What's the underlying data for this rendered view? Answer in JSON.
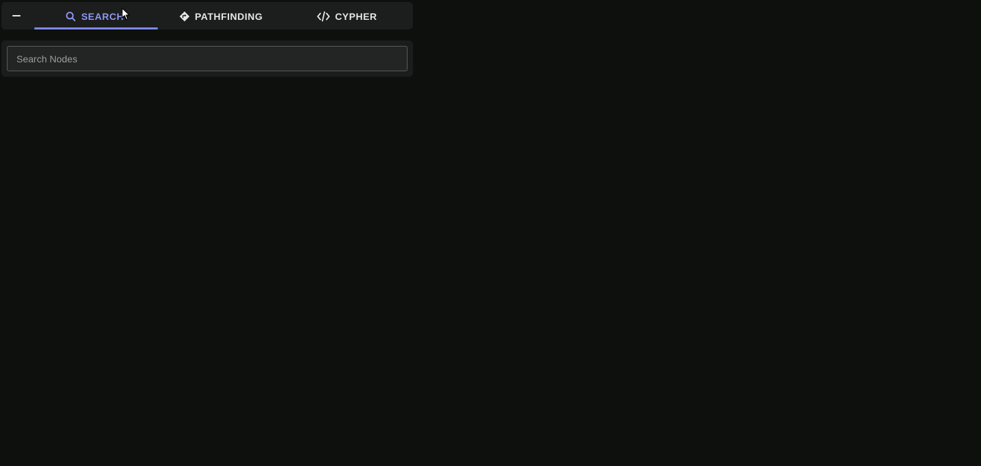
{
  "tabs": [
    {
      "label": "SEARCH",
      "icon": "search-icon",
      "active": true
    },
    {
      "label": "PATHFINDING",
      "icon": "diamond-turn-icon",
      "active": false
    },
    {
      "label": "CYPHER",
      "icon": "code-icon",
      "active": false
    }
  ],
  "search": {
    "placeholder": "Search Nodes"
  },
  "colors": {
    "background": "#0e100e",
    "panel": "#1c1d1d",
    "accent": "#7f89ea",
    "active_text": "#8d97f0",
    "text": "#e6e6e6"
  }
}
